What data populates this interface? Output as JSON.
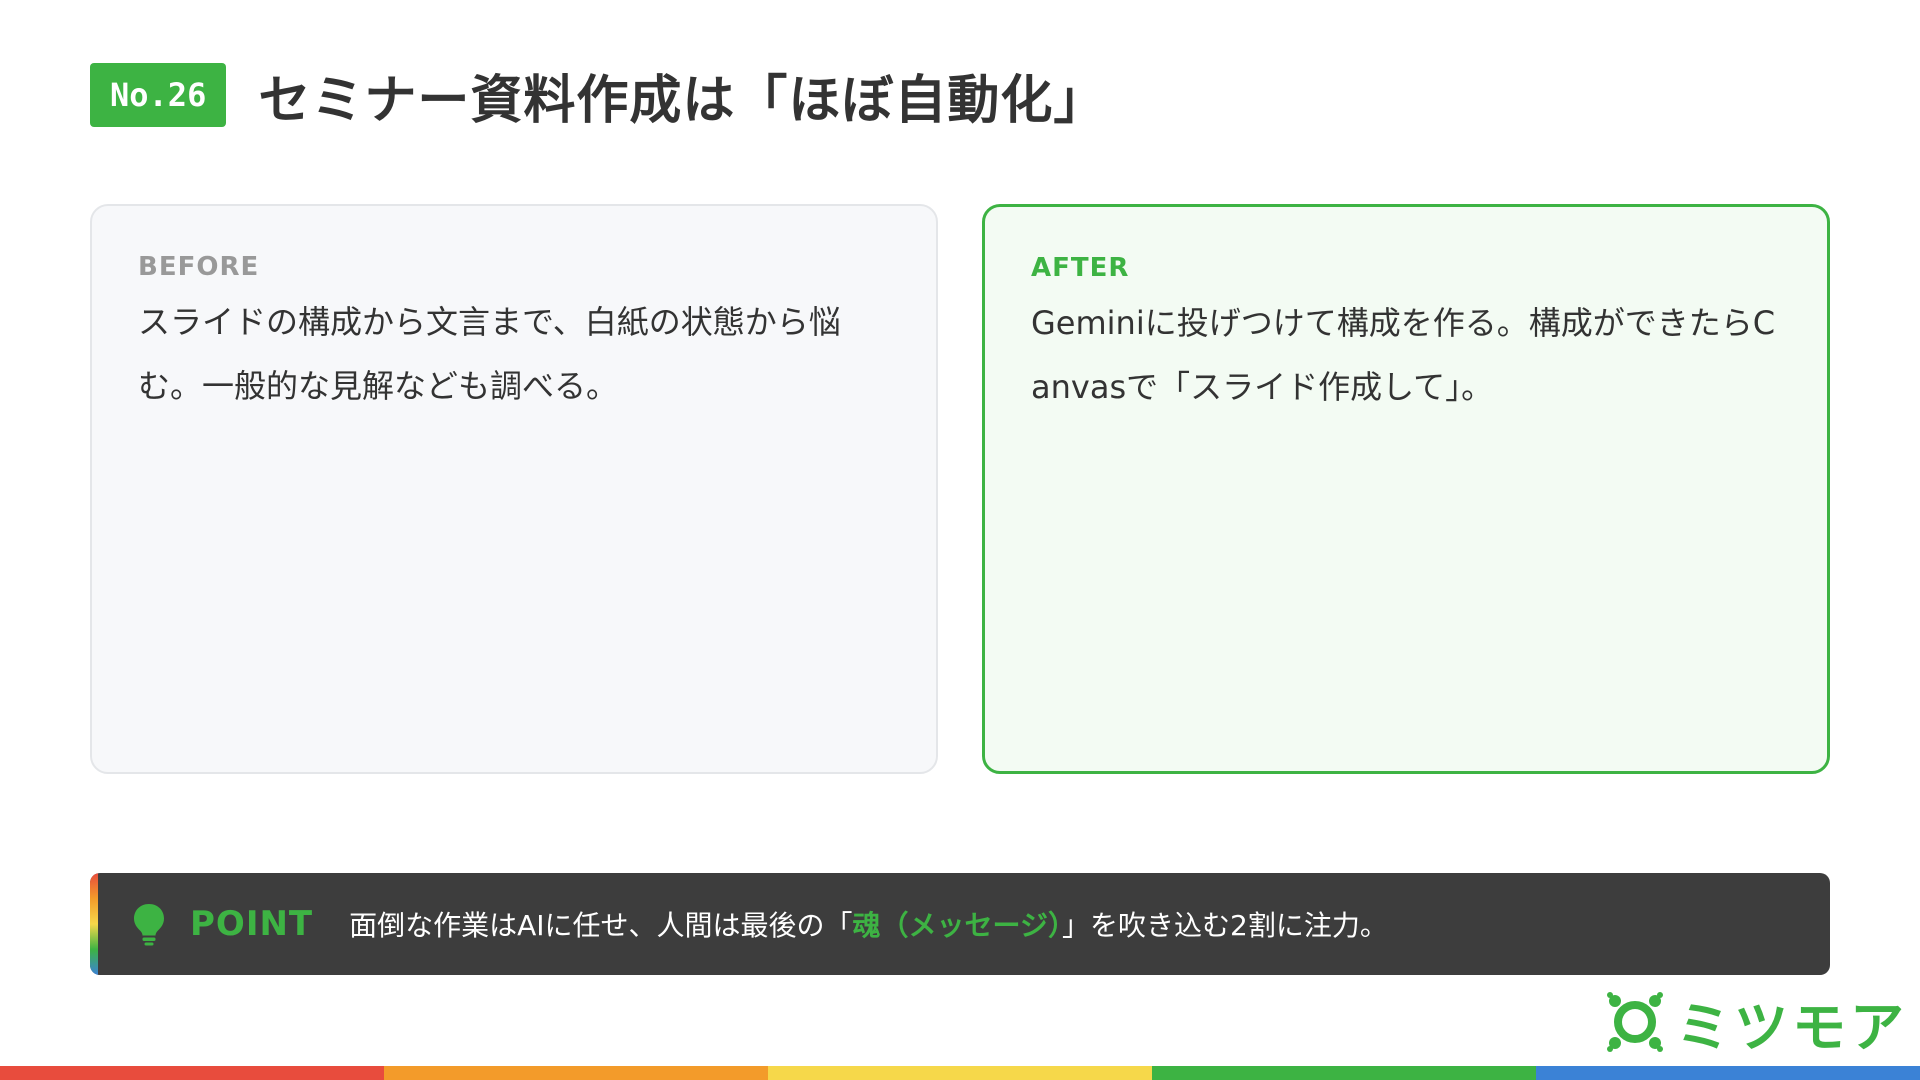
{
  "colors": {
    "accent_green": "#3db343",
    "dark_bar": "#3d3d3d",
    "before_bg": "#f7f8fa",
    "after_bg": "#f3fbf3"
  },
  "header": {
    "badge": "No.26",
    "title": "セミナー資料作成は「ほぼ自動化」"
  },
  "before": {
    "label": "BEFORE",
    "text": "スライドの構成から文言まで、白紙の状態から悩む。一般的な見解なども調べる。"
  },
  "after": {
    "label": "AFTER",
    "text": "Geminiに投げつけて構成を作る。構成ができたらCanvasで「スライド作成して」。"
  },
  "point": {
    "icon": "lightbulb-icon",
    "label": "POINT",
    "text_before": "面倒な作業はAIに任せ、人間は最後の「",
    "highlight": "魂（メッセージ）",
    "text_after": "」を吹き込む2割に注力。"
  },
  "logo": {
    "icon": "mitsumoa-logo-icon",
    "text": "ミツモア"
  },
  "strip_colors": [
    "#e84c3d",
    "#f39b2a",
    "#f6d84a",
    "#3db343",
    "#3b82d6"
  ]
}
